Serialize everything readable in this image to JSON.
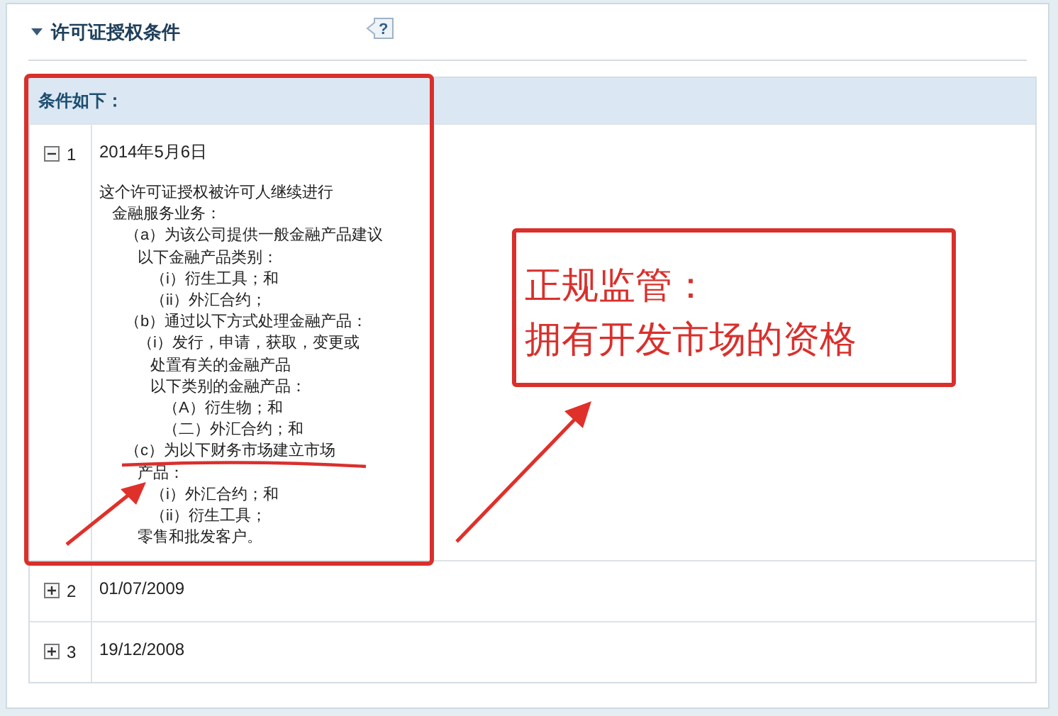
{
  "section": {
    "title": "许可证授权条件",
    "expanded": true,
    "help": "?"
  },
  "table": {
    "header": "条件如下：",
    "rows": [
      {
        "number": "1",
        "expanded": true,
        "date": "2014年5月6日",
        "lines": [
          {
            "text": "这个许可证授权被许可人继续进行",
            "children": [
              {
                "text": "金融服务业务：",
                "children": [
                  {
                    "text": "（a）为该公司提供一般金融产品建议",
                    "children": [
                      {
                        "text": "以下金融产品类别：",
                        "children": [
                          {
                            "text": "（i）衍生工具；和"
                          },
                          {
                            "text": "（ii）外汇合约；"
                          }
                        ]
                      }
                    ]
                  },
                  {
                    "text": "（b）通过以下方式处理金融产品：",
                    "children": [
                      {
                        "text": "（i）发行，申请，获取，变更或",
                        "children": [
                          {
                            "text": "处置有关的金融产品"
                          },
                          {
                            "text": "以下类别的金融产品：",
                            "children": [
                              {
                                "text": "（A）衍生物；和"
                              },
                              {
                                "text": "（二）外汇合约；和"
                              }
                            ]
                          }
                        ]
                      }
                    ]
                  },
                  {
                    "text": "（c）为以下财务市场建立市场",
                    "children": [
                      {
                        "text": "产品：",
                        "children": [
                          {
                            "text": "（i）外汇合约；和"
                          },
                          {
                            "text": "（ii）衍生工具；"
                          }
                        ]
                      },
                      {
                        "text": "零售和批发客户。"
                      }
                    ]
                  }
                ]
              }
            ]
          }
        ]
      },
      {
        "number": "2",
        "expanded": false,
        "date": "01/07/2009"
      },
      {
        "number": "3",
        "expanded": false,
        "date": "19/12/2008"
      }
    ]
  },
  "annotation": {
    "lines": [
      "正规监管：",
      "拥有开发市场的资格"
    ]
  }
}
